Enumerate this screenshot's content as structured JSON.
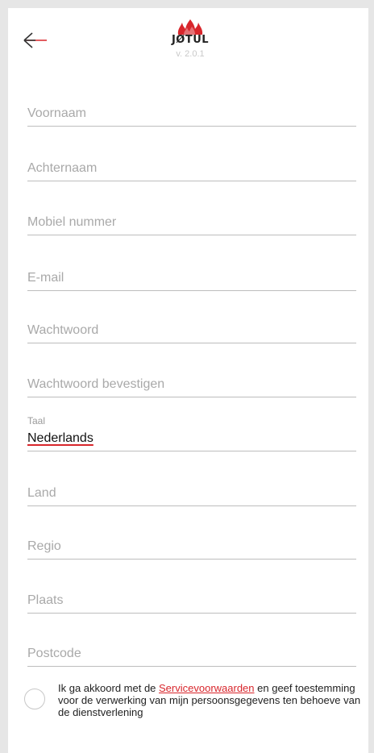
{
  "header": {
    "brand": "JØTUL",
    "version": "v. 2.0.1",
    "back_icon": "arrow-left-icon",
    "logo_icon": "flame-logo-icon",
    "accent_color": "#d8262c"
  },
  "form": {
    "first_name": "Voornaam",
    "last_name": "Achternaam",
    "mobile": "Mobiel nummer",
    "email": "E-mail",
    "password": "Wachtwoord",
    "password_confirm": "Wachtwoord bevestigen",
    "language_label": "Taal",
    "language_value": "Nederlands",
    "country": "Land",
    "region": "Regio",
    "city": "Plaats",
    "postcode": "Postcode"
  },
  "consent": {
    "text_before": "Ik ga akkoord met de ",
    "link": "Servicevoorwaarden",
    "text_after": " en geef toestemming voor de verwerking van mijn persoonsgegevens ten behoeve van de dienstverlening",
    "checked": false
  }
}
